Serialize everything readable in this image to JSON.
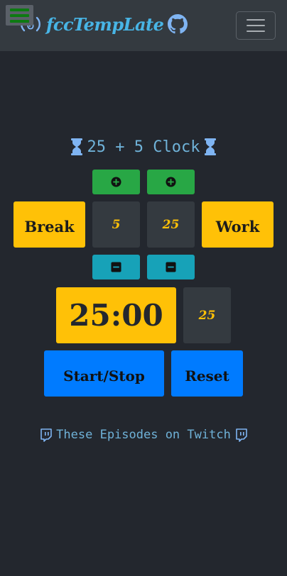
{
  "navbar": {
    "brand": "fccTempLate",
    "icons": [
      "menu-icon",
      "freecodecamp-logo-icon",
      "github-icon",
      "hamburger-toggle-icon"
    ]
  },
  "clock": {
    "title": "25 + 5 Clock",
    "break_label": "Break",
    "work_label": "Work",
    "break_value": "5",
    "work_value": "25",
    "timer": "25:00",
    "session_value": "25",
    "start_stop_label": "Start/Stop",
    "reset_label": "Reset"
  },
  "footer": {
    "twitch_text": "These Episodes on Twitch"
  },
  "colors": {
    "background": "#23272e",
    "navbar": "#343a40",
    "green": "#28a745",
    "teal": "#17a2b8",
    "yellow": "#ffc107",
    "blue": "#007bff",
    "accent_text": "#6fb2d8"
  }
}
